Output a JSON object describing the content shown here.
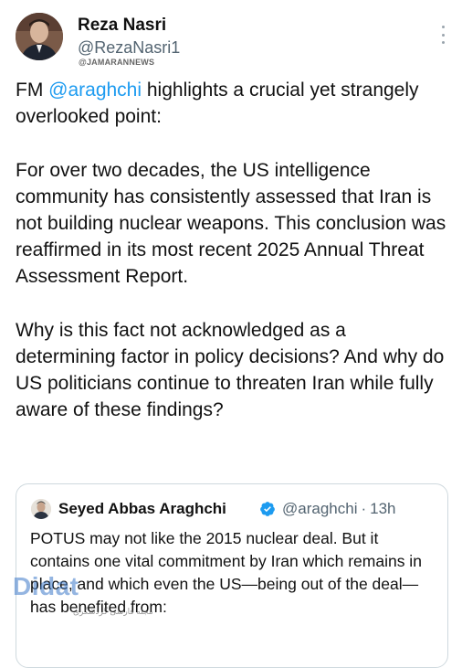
{
  "author": {
    "name": "Reza Nasri",
    "handle": "@RezaNasri1",
    "source_tag": "@JAMARANNEWS"
  },
  "tweet": {
    "mention": "@araghchi",
    "paragraph1_prefix": "FM ",
    "paragraph1_suffix": " highlights a crucial yet strangely overlooked point:",
    "paragraph2": "For over two decades, the US intelligence community has consistently assessed that Iran is not building nuclear weapons. This conclusion was reaffirmed in its most recent 2025 Annual Threat Assessment Report.",
    "paragraph3": "Why is this fact not acknowledged as a determining factor in policy decisions? And why do US politicians continue to threaten Iran while fully aware of these findings?"
  },
  "quoted": {
    "name": "Seyed Abbas Araghchi",
    "handle": "@araghchi",
    "separator": "·",
    "time": "13h",
    "text": "POTUS may not like the 2015 nuclear deal. But it contains one vital commitment by Iran which remains in place, and which even the US—being out of the deal—has benefited from:"
  },
  "site_watermark": {
    "text": "Didat",
    "subtext": "مجله فارسی گردشگری"
  },
  "colors": {
    "mention": "#1d9bf0",
    "verified": "#1d9bf0",
    "secondary_text": "#536471"
  },
  "icons": {
    "more": "more-vertical-icon",
    "verified": "verified-badge-icon"
  }
}
